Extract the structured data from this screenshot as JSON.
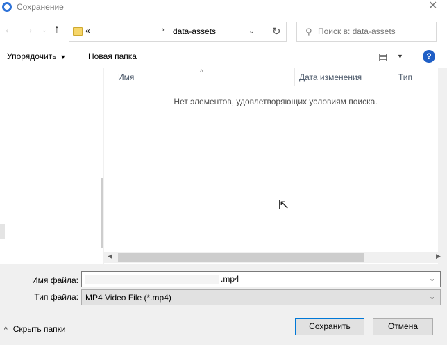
{
  "window": {
    "title": "Сохранение"
  },
  "nav": {
    "back_glyph": "←",
    "forward_glyph": "→",
    "history_glyph": "⌄",
    "up_glyph": "↑"
  },
  "address": {
    "prefix": "«",
    "separator": "›",
    "path": "data-assets",
    "chevron": "⌄",
    "refresh_glyph": "↻"
  },
  "search": {
    "placeholder": "Поиск в: data-assets",
    "icon_glyph": "⚲"
  },
  "toolbar": {
    "organize_label": "Упорядочить",
    "organize_arrow": "▼",
    "new_folder_label": "Новая папка",
    "view_glyph": "▤",
    "view_arrow": "▼",
    "help_glyph": "?"
  },
  "file_list": {
    "columns": [
      "Имя",
      "Дата изменения",
      "Тип"
    ],
    "sort_glyph": "^",
    "empty_message": "Нет элементов, удовлетворяющих условиям поиска.",
    "scroll_left": "◀",
    "scroll_right": "▶"
  },
  "form": {
    "file_name_label": "Имя файла:",
    "file_name_value": ".mp4",
    "file_type_label": "Тип файла:",
    "file_type_value": "MP4 Video File (*.mp4)",
    "chevron": "⌄"
  },
  "footer": {
    "hide_folders_arrow": "^",
    "hide_folders_label": "Скрыть папки",
    "save_label": "Сохранить",
    "cancel_label": "Отмена"
  },
  "colors": {
    "accent": "#0078d7",
    "help": "#1f5fc6",
    "folder": "#f6d66a"
  }
}
